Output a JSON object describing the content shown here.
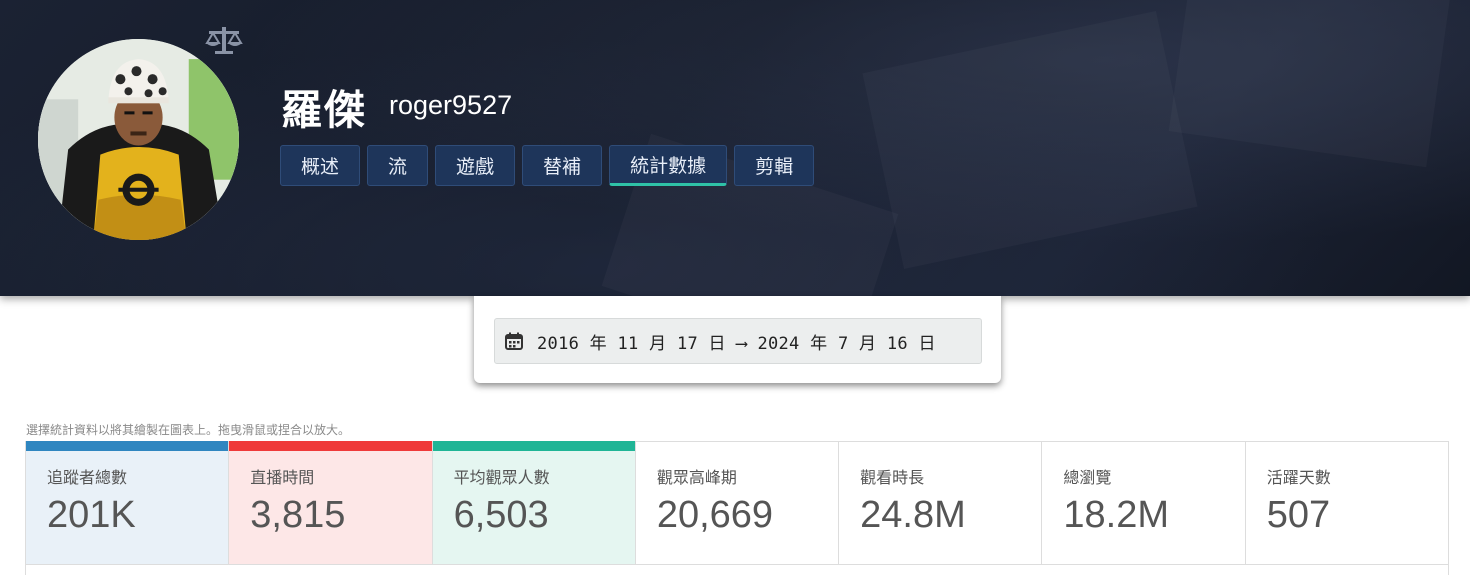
{
  "profile": {
    "display_name": "羅傑",
    "username": "roger9527"
  },
  "tabs": [
    {
      "label": "概述",
      "active": false
    },
    {
      "label": "流",
      "active": false
    },
    {
      "label": "遊戲",
      "active": false
    },
    {
      "label": "替補",
      "active": false
    },
    {
      "label": "統計數據",
      "active": true
    },
    {
      "label": "剪輯",
      "active": false
    }
  ],
  "date_range": {
    "text": "2016 年 11 月 17 日 ⟶ 2024 年 7 月 16 日"
  },
  "hint": "選擇統計資料以將其繪製在圖表上。拖曳滑鼠或捏合以放大。",
  "stats": [
    {
      "label": "追蹤者總數",
      "value": "201K",
      "accent": "#2f86c0",
      "bg": "#e9f1f8",
      "selected": true
    },
    {
      "label": "直播時間",
      "value": "3,815",
      "accent": "#ef3a3a",
      "bg": "#fde7e7",
      "selected": true
    },
    {
      "label": "平均觀眾人數",
      "value": "6,503",
      "accent": "#1fb596",
      "bg": "#e5f6f1",
      "selected": true
    },
    {
      "label": "觀眾高峰期",
      "value": "20,669",
      "accent": "",
      "bg": "#ffffff",
      "selected": false
    },
    {
      "label": "觀看時長",
      "value": "24.8M",
      "accent": "",
      "bg": "#ffffff",
      "selected": false
    },
    {
      "label": "總瀏覽",
      "value": "18.2M",
      "accent": "",
      "bg": "#ffffff",
      "selected": false
    },
    {
      "label": "活躍天數",
      "value": "507",
      "accent": "",
      "bg": "#ffffff",
      "selected": false
    }
  ],
  "colors": {
    "tab_bg": "#1e355a",
    "tab_active_underline": "#2fc2a7"
  },
  "icons": {
    "scale": "scale-icon",
    "calendar": "calendar-icon"
  }
}
